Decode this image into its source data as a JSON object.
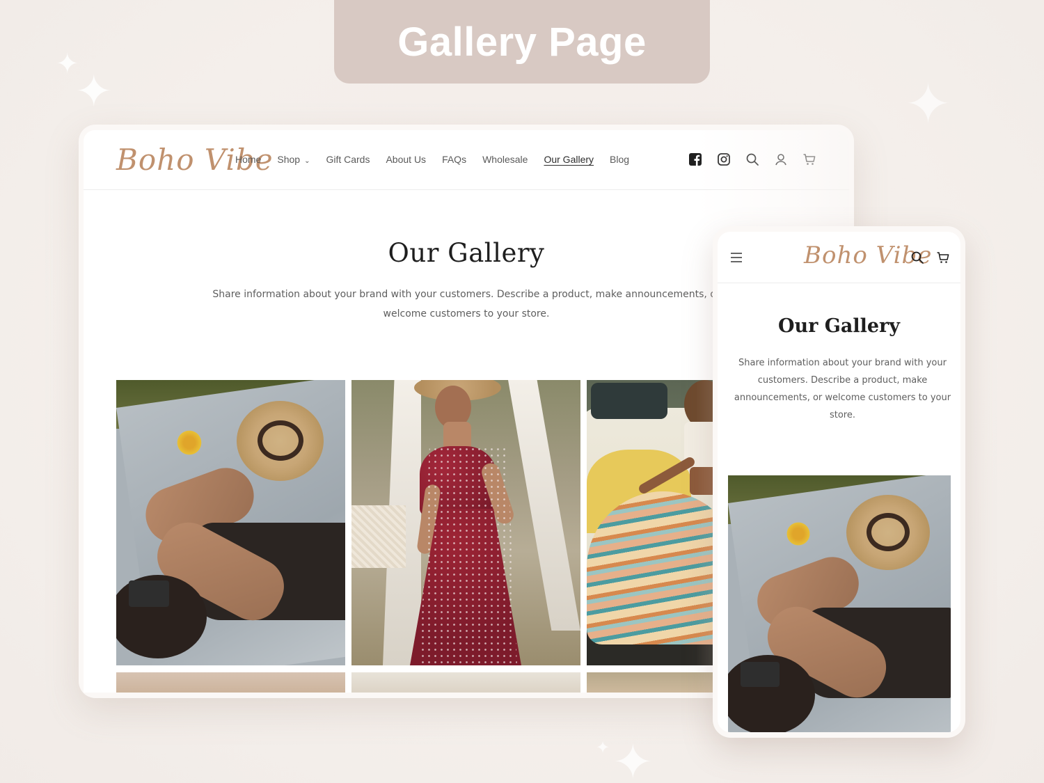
{
  "banner": {
    "title": "Gallery Page"
  },
  "brand": {
    "logo_text": "Boho Vibe",
    "accent_color": "#c0916e"
  },
  "desktop": {
    "nav": {
      "items": [
        {
          "label": "Home"
        },
        {
          "label": "Shop",
          "has_dropdown": true
        },
        {
          "label": "Gift Cards"
        },
        {
          "label": "About Us"
        },
        {
          "label": "FAQs"
        },
        {
          "label": "Wholesale"
        },
        {
          "label": "Our Gallery",
          "active": true
        },
        {
          "label": "Blog"
        }
      ]
    },
    "header_icons": [
      "facebook-icon",
      "instagram-icon",
      "search-icon",
      "account-icon",
      "cart-icon"
    ],
    "page_title": "Our Gallery",
    "description": "Share information about your brand with your customers. Describe a product, make announcements, or welcome customers to your store.",
    "gallery": [
      "photo-lying-on-blanket-with-hat",
      "photo-red-floral-dress",
      "photo-boho-skirt-with-van"
    ]
  },
  "mobile": {
    "header_icons": [
      "menu-icon",
      "search-icon",
      "cart-icon"
    ],
    "page_title": "Our Gallery",
    "description": "Share information about your brand with your customers. Describe a product, make announcements, or welcome customers to your store.",
    "gallery": [
      "photo-lying-on-blanket-with-hat"
    ]
  }
}
